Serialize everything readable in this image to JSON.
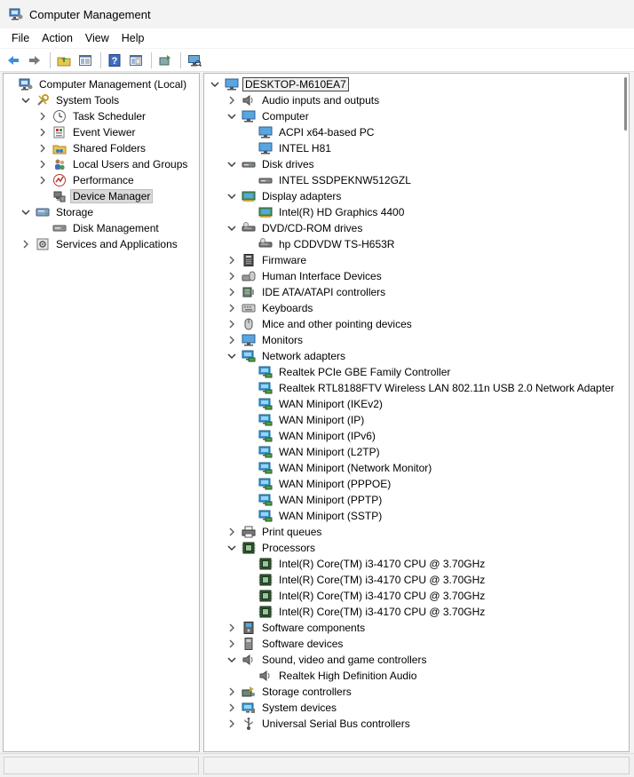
{
  "window": {
    "title": "Computer Management"
  },
  "menu": [
    "File",
    "Action",
    "View",
    "Help"
  ],
  "toolbar": [
    {
      "icon": "back-arrow-icon"
    },
    {
      "icon": "forward-arrow-icon"
    },
    {
      "icon": "up-folder-icon"
    },
    {
      "icon": "show-hide-tree-icon"
    },
    {
      "icon": "help-icon"
    },
    {
      "icon": "properties-icon"
    },
    {
      "icon": "update-driver-icon"
    },
    {
      "icon": "scan-hardware-icon"
    }
  ],
  "left_tree": [
    {
      "label": "Computer Management (Local)",
      "depth": 0,
      "chev": "none",
      "icon": "computer-management-icon"
    },
    {
      "label": "System Tools",
      "depth": 1,
      "chev": "down",
      "icon": "tools-icon"
    },
    {
      "label": "Task Scheduler",
      "depth": 2,
      "chev": "right",
      "icon": "clock-icon"
    },
    {
      "label": "Event Viewer",
      "depth": 2,
      "chev": "right",
      "icon": "event-viewer-icon"
    },
    {
      "label": "Shared Folders",
      "depth": 2,
      "chev": "right",
      "icon": "shared-folder-icon"
    },
    {
      "label": "Local Users and Groups",
      "depth": 2,
      "chev": "right",
      "icon": "users-icon"
    },
    {
      "label": "Performance",
      "depth": 2,
      "chev": "right",
      "icon": "performance-icon"
    },
    {
      "label": "Device Manager",
      "depth": 2,
      "chev": "none",
      "icon": "device-manager-icon",
      "selected": true
    },
    {
      "label": "Storage",
      "depth": 1,
      "chev": "down",
      "icon": "storage-icon"
    },
    {
      "label": "Disk Management",
      "depth": 2,
      "chev": "none",
      "icon": "disk-icon"
    },
    {
      "label": "Services and Applications",
      "depth": 1,
      "chev": "right",
      "icon": "services-icon"
    }
  ],
  "device_tree": [
    {
      "label": "DESKTOP-M610EA7",
      "depth": 0,
      "chev": "down",
      "icon": "computer-icon",
      "boxed": true
    },
    {
      "label": "Audio inputs and outputs",
      "depth": 1,
      "chev": "right",
      "icon": "speaker-icon"
    },
    {
      "label": "Computer",
      "depth": 1,
      "chev": "down",
      "icon": "monitor-icon"
    },
    {
      "label": "ACPI x64-based PC",
      "depth": 2,
      "chev": "none",
      "icon": "monitor-icon"
    },
    {
      "label": "INTEL H81",
      "depth": 2,
      "chev": "none",
      "icon": "monitor-icon"
    },
    {
      "label": "Disk drives",
      "depth": 1,
      "chev": "down",
      "icon": "disk-drive-icon"
    },
    {
      "label": "INTEL SSDPEKNW512GZL",
      "depth": 2,
      "chev": "none",
      "icon": "disk-drive-icon"
    },
    {
      "label": "Display adapters",
      "depth": 1,
      "chev": "down",
      "icon": "display-adapter-icon"
    },
    {
      "label": "Intel(R) HD Graphics 4400",
      "depth": 2,
      "chev": "none",
      "icon": "display-adapter-icon"
    },
    {
      "label": "DVD/CD-ROM drives",
      "depth": 1,
      "chev": "down",
      "icon": "dvd-drive-icon"
    },
    {
      "label": "hp CDDVDW TS-H653R",
      "depth": 2,
      "chev": "none",
      "icon": "dvd-drive-icon"
    },
    {
      "label": "Firmware",
      "depth": 1,
      "chev": "right",
      "icon": "firmware-icon"
    },
    {
      "label": "Human Interface Devices",
      "depth": 1,
      "chev": "right",
      "icon": "hid-icon"
    },
    {
      "label": "IDE ATA/ATAPI controllers",
      "depth": 1,
      "chev": "right",
      "icon": "ide-controller-icon"
    },
    {
      "label": "Keyboards",
      "depth": 1,
      "chev": "right",
      "icon": "keyboard-icon"
    },
    {
      "label": "Mice and other pointing devices",
      "depth": 1,
      "chev": "right",
      "icon": "mouse-icon"
    },
    {
      "label": "Monitors",
      "depth": 1,
      "chev": "right",
      "icon": "monitor-icon"
    },
    {
      "label": "Network adapters",
      "depth": 1,
      "chev": "down",
      "icon": "network-adapter-icon"
    },
    {
      "label": "Realtek PCIe GBE Family Controller",
      "depth": 2,
      "chev": "none",
      "icon": "network-adapter-icon"
    },
    {
      "label": "Realtek RTL8188FTV Wireless LAN 802.11n USB 2.0 Network Adapter",
      "depth": 2,
      "chev": "none",
      "icon": "network-adapter-icon"
    },
    {
      "label": "WAN Miniport (IKEv2)",
      "depth": 2,
      "chev": "none",
      "icon": "network-adapter-icon"
    },
    {
      "label": "WAN Miniport (IP)",
      "depth": 2,
      "chev": "none",
      "icon": "network-adapter-icon"
    },
    {
      "label": "WAN Miniport (IPv6)",
      "depth": 2,
      "chev": "none",
      "icon": "network-adapter-icon"
    },
    {
      "label": "WAN Miniport (L2TP)",
      "depth": 2,
      "chev": "none",
      "icon": "network-adapter-icon"
    },
    {
      "label": "WAN Miniport (Network Monitor)",
      "depth": 2,
      "chev": "none",
      "icon": "network-adapter-icon"
    },
    {
      "label": "WAN Miniport (PPPOE)",
      "depth": 2,
      "chev": "none",
      "icon": "network-adapter-icon"
    },
    {
      "label": "WAN Miniport (PPTP)",
      "depth": 2,
      "chev": "none",
      "icon": "network-adapter-icon"
    },
    {
      "label": "WAN Miniport (SSTP)",
      "depth": 2,
      "chev": "none",
      "icon": "network-adapter-icon"
    },
    {
      "label": "Print queues",
      "depth": 1,
      "chev": "right",
      "icon": "printer-icon"
    },
    {
      "label": "Processors",
      "depth": 1,
      "chev": "down",
      "icon": "processor-icon"
    },
    {
      "label": "Intel(R) Core(TM) i3-4170 CPU @ 3.70GHz",
      "depth": 2,
      "chev": "none",
      "icon": "processor-icon"
    },
    {
      "label": "Intel(R) Core(TM) i3-4170 CPU @ 3.70GHz",
      "depth": 2,
      "chev": "none",
      "icon": "processor-icon"
    },
    {
      "label": "Intel(R) Core(TM) i3-4170 CPU @ 3.70GHz",
      "depth": 2,
      "chev": "none",
      "icon": "processor-icon"
    },
    {
      "label": "Intel(R) Core(TM) i3-4170 CPU @ 3.70GHz",
      "depth": 2,
      "chev": "none",
      "icon": "processor-icon"
    },
    {
      "label": "Software components",
      "depth": 1,
      "chev": "right",
      "icon": "software-component-icon"
    },
    {
      "label": "Software devices",
      "depth": 1,
      "chev": "right",
      "icon": "software-device-icon"
    },
    {
      "label": "Sound, video and game controllers",
      "depth": 1,
      "chev": "down",
      "icon": "speaker-icon"
    },
    {
      "label": "Realtek High Definition Audio",
      "depth": 2,
      "chev": "none",
      "icon": "speaker-icon"
    },
    {
      "label": "Storage controllers",
      "depth": 1,
      "chev": "right",
      "icon": "storage-controller-icon"
    },
    {
      "label": "System devices",
      "depth": 1,
      "chev": "right",
      "icon": "system-device-icon"
    },
    {
      "label": "Universal Serial Bus controllers",
      "depth": 1,
      "chev": "right",
      "icon": "usb-icon"
    }
  ],
  "colors": {
    "accent": "#2f8fd8",
    "selection": "#d9d9d9",
    "chip": "#3b7a3b"
  }
}
